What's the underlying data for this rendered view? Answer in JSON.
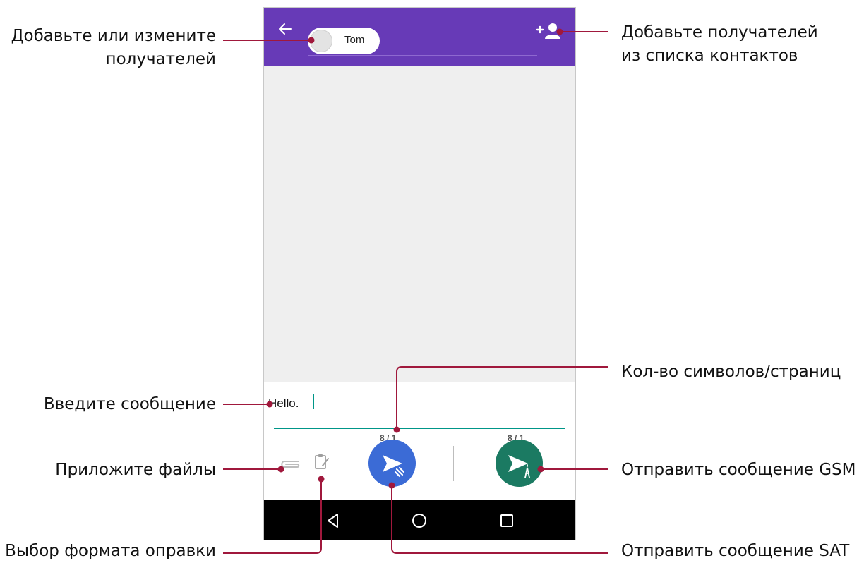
{
  "header": {
    "recipient_name": "Tom"
  },
  "compose": {
    "message_text": "Hello.",
    "sat_counter": "8 / 1",
    "gsm_counter": "8 / 1"
  },
  "annotations": {
    "add_edit_recipients": "Добавьте или измените получателей",
    "add_from_contacts": "Добавьте получателей из списка контактов",
    "char_page_count": "Кол-во символов/страниц",
    "enter_message": "Введите сообщение",
    "attach_files": "Приложите файлы",
    "send_gsm": "Отправить сообщение GSM",
    "signature_format": "Выбор формата оправки",
    "send_sat": "Отправить сообщение SAT"
  },
  "icons": {
    "back": "arrow-left-icon",
    "add_contact": "person-add-icon",
    "attach": "paperclip-icon",
    "format": "clipboard-edit-icon",
    "send_sat": "send-satellite-icon",
    "send_gsm": "send-tower-icon",
    "nav_back": "triangle-back-icon",
    "nav_home": "circle-home-icon",
    "nav_recents": "square-recents-icon"
  },
  "colors": {
    "app_bar": "#673ab7",
    "accent_underline": "#009688",
    "sat_button": "#3b6bd6",
    "gsm_button": "#1b7a62",
    "callout_line": "#a0183c"
  }
}
